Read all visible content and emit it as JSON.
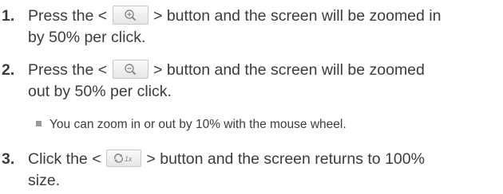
{
  "steps": [
    {
      "number": "1.",
      "line1_before": "Press the <",
      "line1_after": "> button and the screen will be zoomed in",
      "line2": "by 50% per click.",
      "icon": "zoom-in-icon"
    },
    {
      "number": "2.",
      "line1_before": "Press the <",
      "line1_after": "> button and the screen will be zoomed",
      "line2": "out by 50% per click.",
      "icon": "zoom-out-icon"
    },
    {
      "number": "3.",
      "line1_before": "Click the <",
      "line1_after": "> button and the screen returns to 100%",
      "line2": "size.",
      "icon": "reset-zoom-icon",
      "icon_label": "1x"
    }
  ],
  "note": "You can zoom in or out by 10% with the mouse wheel.",
  "colors": {
    "text": "#3c3c3c",
    "bullet": "#9a9a9a",
    "button_border": "#c9c9c9",
    "icon": "#8a8a8a"
  }
}
